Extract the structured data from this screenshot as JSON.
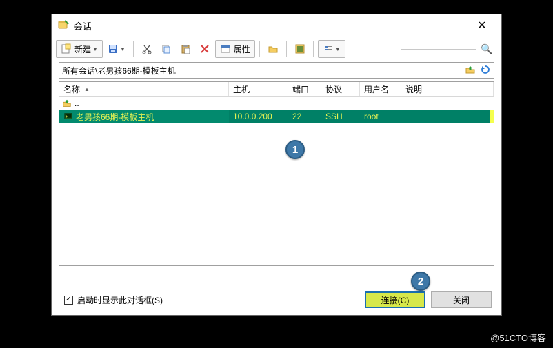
{
  "window": {
    "title": "会话"
  },
  "toolbar": {
    "new_label": "新建",
    "props_label": "属性"
  },
  "path": "所有会话\\老男孩66期-模板主机",
  "columns": {
    "name": "名称",
    "host": "主机",
    "port": "端口",
    "protocol": "协议",
    "user": "用户名",
    "desc": "说明"
  },
  "uprow": "..",
  "session": {
    "name": "老男孩66期-模板主机",
    "host": "10.0.0.200",
    "port": "22",
    "protocol": "SSH",
    "user": "root"
  },
  "footer": {
    "checkbox_label": "启动时显示此对话框(S)",
    "connect": "连接(C)",
    "close": "关闭"
  },
  "annotations": {
    "a1": "1",
    "a2": "2"
  },
  "watermark": "@51CTO博客"
}
